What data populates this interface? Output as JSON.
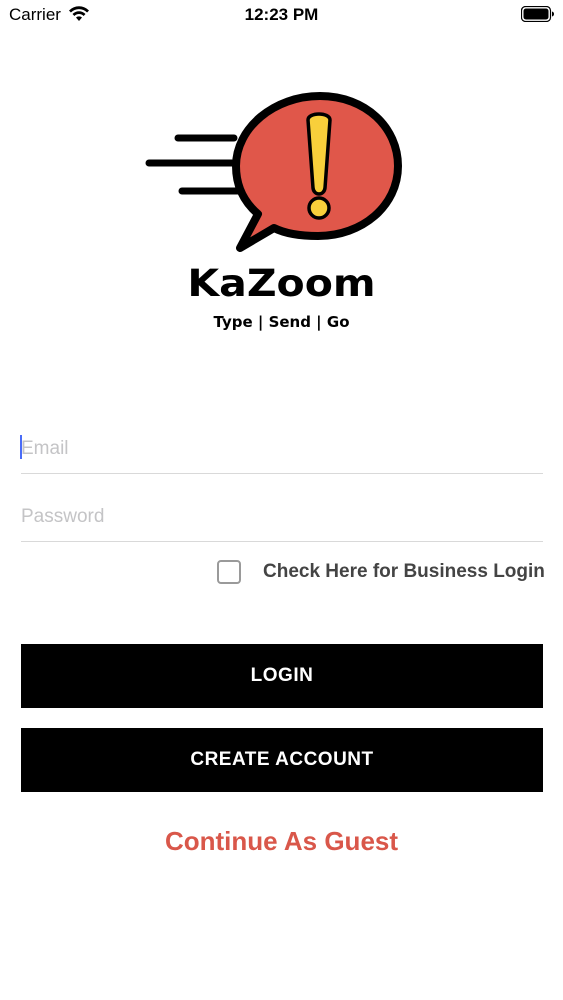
{
  "status_bar": {
    "carrier": "Carrier",
    "time": "12:23 PM"
  },
  "brand": {
    "name": "KaZoom",
    "tagline": "Type | Send | Go",
    "logo_icon": "speech-bubble-exclamation-icon",
    "colors": {
      "bubble": "#e0574a",
      "exclamation": "#f8cf3b",
      "outline": "#000000"
    }
  },
  "form": {
    "email_placeholder": "Email",
    "password_placeholder": "Password",
    "business_login_checked": false,
    "business_login_label": "Check Here for Business Login"
  },
  "buttons": {
    "login_label": "LOGIN",
    "create_account_label": "CREATE ACCOUNT",
    "guest_label": "Continue As Guest"
  },
  "colors": {
    "primary_button": "#000000",
    "guest_link": "#d9574a",
    "caret": "#4a6cf7"
  }
}
